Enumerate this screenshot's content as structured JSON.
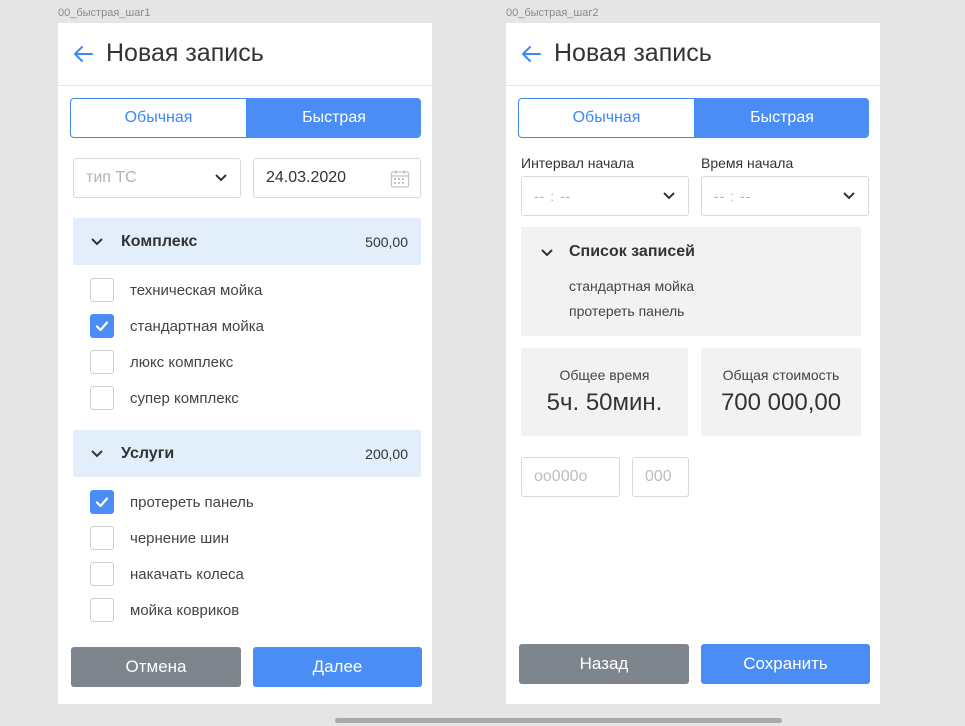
{
  "screens": [
    {
      "frame_label": "00_быстрая_шаг1",
      "title": "Новая запись",
      "tabs": [
        "Обычная",
        "Быстрая"
      ],
      "active_tab": "Быстрая",
      "vehicle_type_placeholder": "тип ТС",
      "date_value": "24.03.2020",
      "sections": [
        {
          "title": "Комплекс",
          "price": "500,00",
          "items": [
            {
              "label": "техническая мойка",
              "checked": false
            },
            {
              "label": "стандартная мойка",
              "checked": true
            },
            {
              "label": "люкс комплекс",
              "checked": false
            },
            {
              "label": "супер комплекс",
              "checked": false
            }
          ]
        },
        {
          "title": "Услуги",
          "price": "200,00",
          "items": [
            {
              "label": "протереть панель",
              "checked": true
            },
            {
              "label": "чернение шин",
              "checked": false
            },
            {
              "label": "накачать колеса",
              "checked": false
            },
            {
              "label": "мойка ковриков",
              "checked": false
            }
          ]
        }
      ],
      "cancel_label": "Отмена",
      "next_label": "Далее"
    },
    {
      "frame_label": "00_быстрая_шаг2",
      "title": "Новая запись",
      "tabs": [
        "Обычная",
        "Быстрая"
      ],
      "active_tab": "Быстрая",
      "interval_label": "Интервал начала",
      "interval_value": "-- : --",
      "start_time_label": "Время начала",
      "start_time_value": "-- : --",
      "records_title": "Список записей",
      "records": [
        "стандартная мойка",
        "протереть панель"
      ],
      "total_time_label": "Общее время",
      "total_time_value": "5ч. 50мин.",
      "total_cost_label": "Общая стоимость",
      "total_cost_value": "700 000,00",
      "code_placeholder_1": "оо000о",
      "code_placeholder_2": "000",
      "back_label": "Назад",
      "save_label": "Сохранить"
    }
  ],
  "colors": {
    "accent": "#4a8ef5",
    "section_bg": "#e3eefb",
    "button_gray": "#7e858c"
  },
  "icons": [
    "back-arrow-icon",
    "chevron-down-icon",
    "calendar-icon",
    "checkmark-icon"
  ]
}
